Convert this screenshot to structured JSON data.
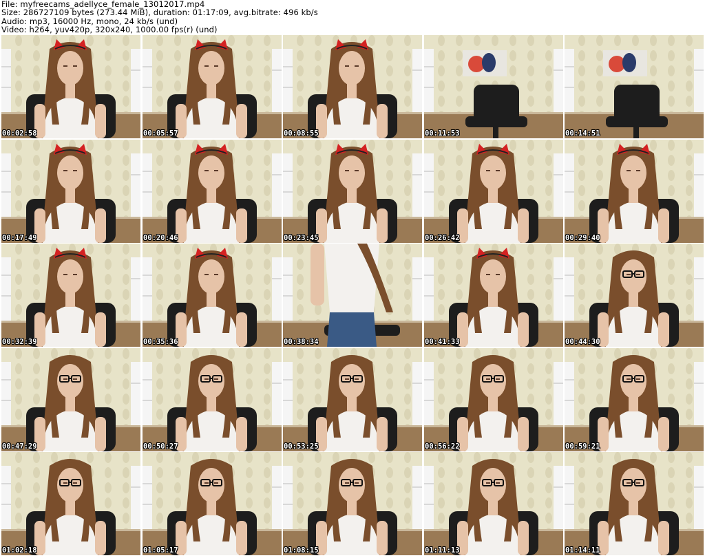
{
  "header": {
    "file_line": "File: myfreecams_adellyce_female_13012017.mp4",
    "size_line": "Size: 286727109 bytes (273.44 MiB), duration: 01:17:09, avg.bitrate: 496 kb/s",
    "audio_line": "Audio: mp3, 16000 Hz, mono, 24 kb/s (und)",
    "video_line": "Video: h264, yuv420p, 320x240, 1000.00 fps(r) (und)"
  },
  "thumbnails": [
    {
      "timestamp": "00:02:58",
      "scene": "person-cat-ears"
    },
    {
      "timestamp": "00:05:57",
      "scene": "person-cat-ears"
    },
    {
      "timestamp": "00:08:55",
      "scene": "person-cat-ears"
    },
    {
      "timestamp": "00:11:53",
      "scene": "empty-chair"
    },
    {
      "timestamp": "00:14:51",
      "scene": "empty-chair"
    },
    {
      "timestamp": "00:17:49",
      "scene": "person-cat-ears"
    },
    {
      "timestamp": "00:20:46",
      "scene": "person-cat-ears"
    },
    {
      "timestamp": "00:23:45",
      "scene": "person-cat-ears"
    },
    {
      "timestamp": "00:26:42",
      "scene": "person-cat-ears"
    },
    {
      "timestamp": "00:29:40",
      "scene": "person-cat-ears"
    },
    {
      "timestamp": "00:32:39",
      "scene": "person-cat-ears"
    },
    {
      "timestamp": "00:35:36",
      "scene": "person-cat-ears"
    },
    {
      "timestamp": "00:38:34",
      "scene": "person-standing"
    },
    {
      "timestamp": "00:41:33",
      "scene": "person-cat-ears"
    },
    {
      "timestamp": "00:44:30",
      "scene": "person-glasses"
    },
    {
      "timestamp": "00:47:29",
      "scene": "person-glasses"
    },
    {
      "timestamp": "00:50:27",
      "scene": "person-glasses"
    },
    {
      "timestamp": "00:53:25",
      "scene": "person-glasses"
    },
    {
      "timestamp": "00:56:22",
      "scene": "person-glasses"
    },
    {
      "timestamp": "00:59:21",
      "scene": "person-glasses"
    },
    {
      "timestamp": "01:02:18",
      "scene": "person-glasses"
    },
    {
      "timestamp": "01:05:17",
      "scene": "person-glasses"
    },
    {
      "timestamp": "01:08:15",
      "scene": "person-glasses"
    },
    {
      "timestamp": "01:11:13",
      "scene": "person-glasses"
    },
    {
      "timestamp": "01:14:11",
      "scene": "person-glasses"
    }
  ],
  "colors": {
    "wall": "#e7e3c8",
    "wall_pattern": "#cfc9a6",
    "floor": "#9a7a55",
    "chair": "#1d1d1d",
    "hair": "#7a4e2c",
    "skin": "#e6c3a8",
    "top": "#f3f1ee",
    "ears": "#d42222",
    "jeans": "#3a5a85",
    "shelf": "#f5f5f5"
  }
}
